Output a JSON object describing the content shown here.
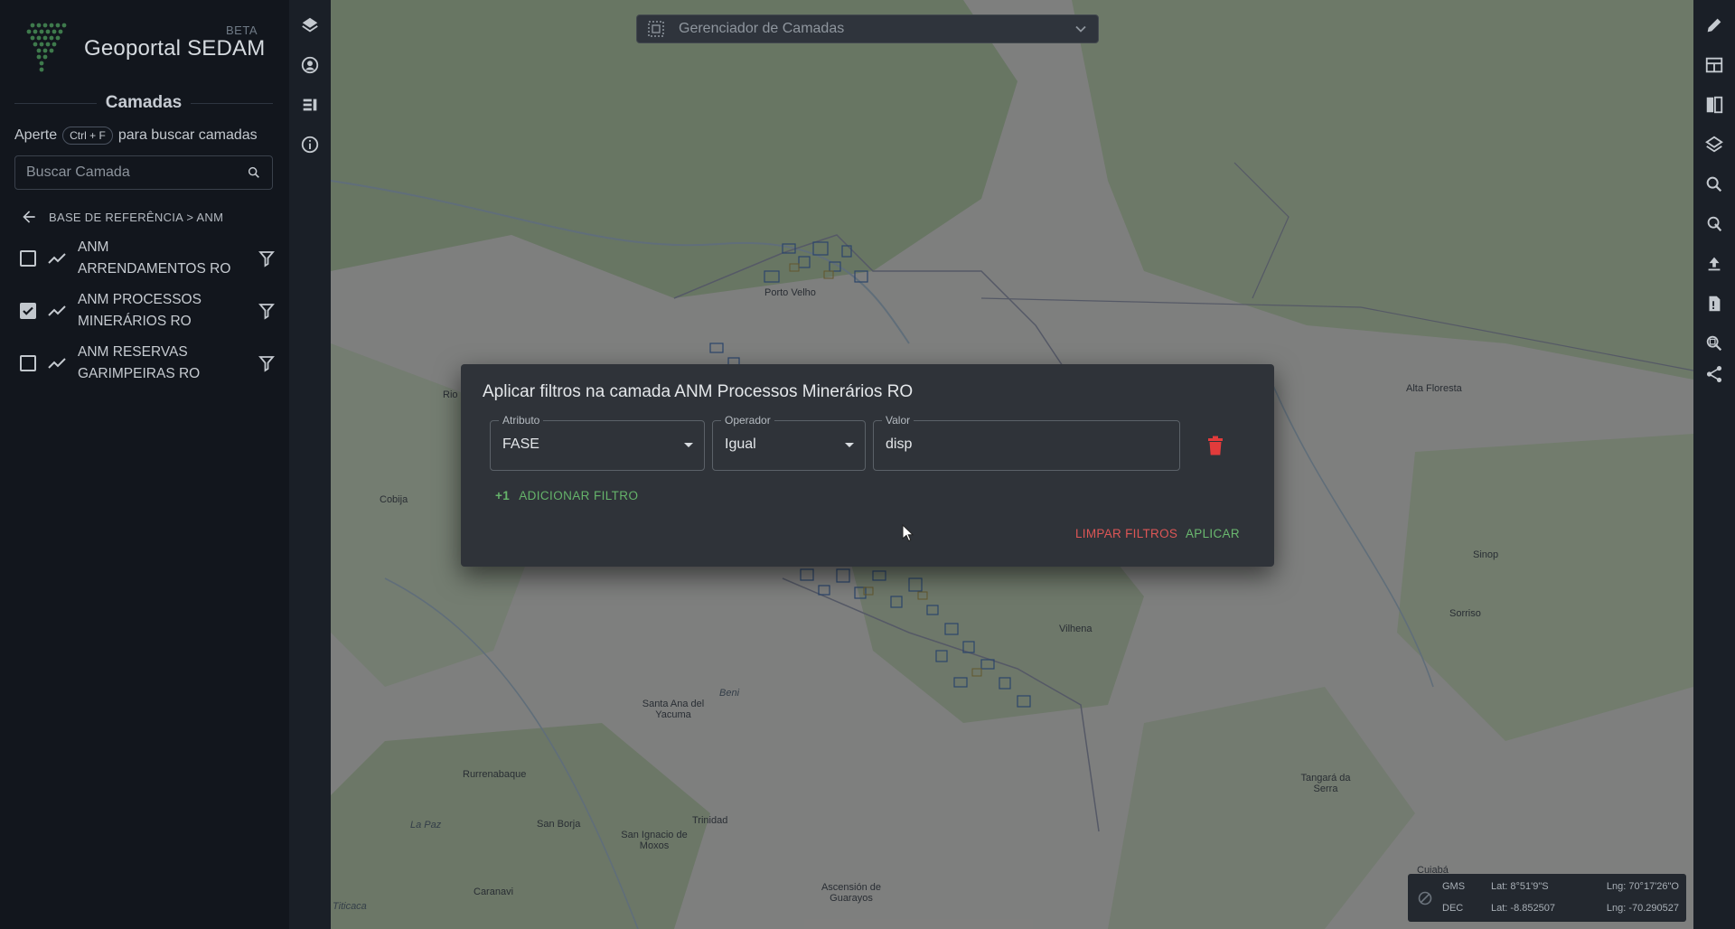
{
  "brand": {
    "name": "Geoportal SEDAM",
    "badge": "BETA"
  },
  "sidebar": {
    "title": "Camadas",
    "hint": {
      "prefix": "Aperte",
      "shortcut": "Ctrl + F",
      "suffix": "para buscar camadas"
    },
    "search": {
      "placeholder": "Buscar Camada",
      "value": ""
    },
    "breadcrumb": "BASE DE REFERÊNCIA > ANM",
    "layers": [
      {
        "label": "ANM ARRENDAMENTOS RO",
        "checked": false
      },
      {
        "label": "ANM PROCESSOS MINERÁRIOS RO",
        "checked": true
      },
      {
        "label": "ANM RESERVAS GARIMPEIRAS RO",
        "checked": false
      }
    ]
  },
  "rail": {
    "icons": [
      "layers-icon",
      "account-icon",
      "legend-icon",
      "info-icon"
    ]
  },
  "toolbar": {
    "icons": [
      "pencil-icon",
      "table-icon",
      "compare-icon",
      "stack-icon",
      "search-icon",
      "identify-icon",
      "upload-icon",
      "report-icon",
      "zoom-area-icon",
      "share-icon"
    ]
  },
  "layer_manager": {
    "label": "Gerenciador de Camadas"
  },
  "map": {
    "places": [
      {
        "name": "Porto Velho"
      },
      {
        "name": "Rio B"
      },
      {
        "name": "Cobija"
      },
      {
        "name": "Alta Floresta"
      },
      {
        "name": "Sinop"
      },
      {
        "name": "Sorriso"
      },
      {
        "name": "Vilhena"
      },
      {
        "name": "Beni"
      },
      {
        "name": "Santa Ana del Yacuma"
      },
      {
        "name": "Rurrenabaque"
      },
      {
        "name": "San Borja"
      },
      {
        "name": "Trinidad"
      },
      {
        "name": "La Paz"
      },
      {
        "name": "San Ignacio de Moxos"
      },
      {
        "name": "Caranavi"
      },
      {
        "name": "Ascensión de Guarayos"
      },
      {
        "name": "Tangará da Serra"
      },
      {
        "name": "Cuiabá"
      },
      {
        "name": "Titicaca"
      }
    ]
  },
  "coords": {
    "gms": {
      "label": "GMS",
      "lat": "Lat: 8°51'9\"S",
      "lng": "Lng: 70°17'26\"O"
    },
    "dec": {
      "label": "DEC",
      "lat": "Lat: -8.852507",
      "lng": "Lng: -70.290527"
    }
  },
  "dialog": {
    "title": "Aplicar filtros na camada ANM Processos Minerários RO",
    "attribute": {
      "label": "Atributo",
      "value": "FASE"
    },
    "operator": {
      "label": "Operador",
      "value": "Igual"
    },
    "value": {
      "label": "Valor",
      "value": "disp"
    },
    "add_filter": {
      "prefix": "+1",
      "label": "ADICIONAR FILTRO"
    },
    "clear_label": "LIMPAR FILTROS",
    "apply_label": "APLICAR"
  },
  "colors": {
    "accent_green": "#6ab86f",
    "danger_red": "#dd5656",
    "panel_bg": "#12161d",
    "dialog_bg": "#2f3339"
  }
}
